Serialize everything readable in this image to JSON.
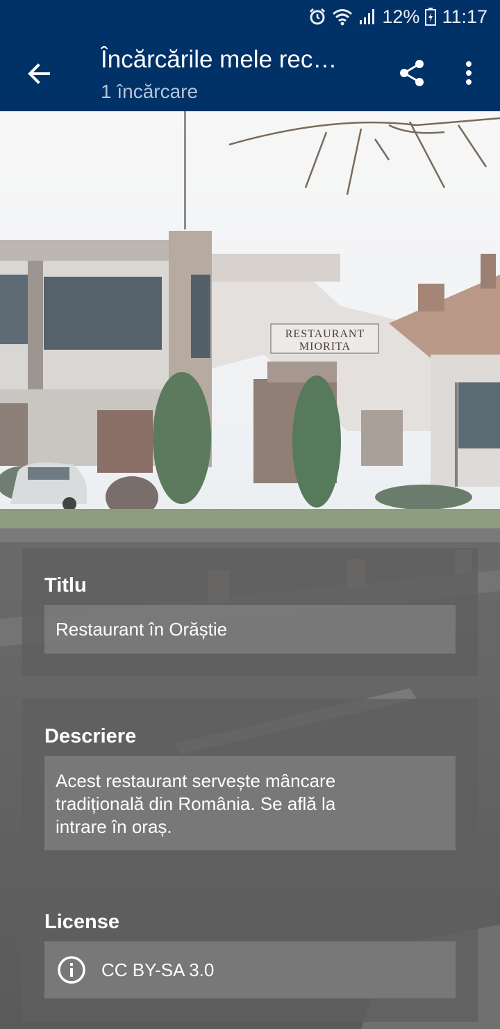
{
  "status_bar": {
    "battery": "12%",
    "time": "11:17",
    "icons": [
      "alarm-icon",
      "wifi-icon",
      "signal-icon",
      "battery-charging-icon"
    ]
  },
  "app_bar": {
    "title": "Încărcările mele rec…",
    "subtitle": "1 încărcare",
    "icons": [
      "back-arrow-icon",
      "share-icon",
      "more-vert-icon"
    ]
  },
  "photo": {
    "sign_line1": "RESTAURANT",
    "sign_line2": "MIORITA"
  },
  "details": {
    "title_label": "Titlu",
    "title_value": "Restaurant în Orăștie",
    "description_label": "Descriere",
    "description_value": "Acest restaurant servește mâncare tradițională din România. Se află la intrare în oraș.",
    "license_label": "License",
    "license_value": "CC BY-SA 3.0"
  },
  "colors": {
    "app_bar": "#003167",
    "card": "#5f5f5f",
    "field": "#7d7d7d"
  }
}
